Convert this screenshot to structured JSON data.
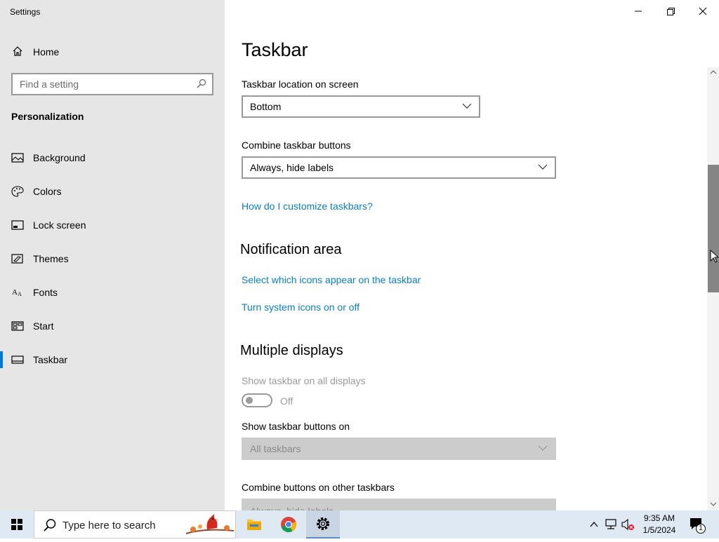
{
  "window": {
    "title": "Settings"
  },
  "sidebar": {
    "home_label": "Home",
    "search_placeholder": "Find a setting",
    "section": "Personalization",
    "items": [
      {
        "label": "Background",
        "icon": "picture-icon"
      },
      {
        "label": "Colors",
        "icon": "palette-icon"
      },
      {
        "label": "Lock screen",
        "icon": "lock-screen-icon"
      },
      {
        "label": "Themes",
        "icon": "themes-icon"
      },
      {
        "label": "Fonts",
        "icon": "fonts-icon"
      },
      {
        "label": "Start",
        "icon": "start-icon"
      },
      {
        "label": "Taskbar",
        "icon": "taskbar-icon",
        "active": true
      }
    ]
  },
  "main": {
    "title": "Taskbar",
    "location_label": "Taskbar location on screen",
    "location_value": "Bottom",
    "combine_label": "Combine taskbar buttons",
    "combine_value": "Always, hide labels",
    "customize_link": "How do I customize taskbars?",
    "notification_heading": "Notification area",
    "select_icons_link": "Select which icons appear on the taskbar",
    "system_icons_link": "Turn system icons on or off",
    "multiple_heading": "Multiple displays",
    "show_all_label": "Show taskbar on all displays",
    "show_all_state": "Off",
    "show_buttons_label": "Show taskbar buttons on",
    "show_buttons_value": "All taskbars",
    "combine_other_label": "Combine buttons on other taskbars",
    "combine_other_value": "Always, hide labels"
  },
  "taskbar": {
    "search_placeholder": "Type here to search",
    "time": "9:35 AM",
    "date": "1/5/2024",
    "notification_count": "1"
  },
  "colors": {
    "accent": "#0078d7",
    "link": "#0a7fc9",
    "sidebar_bg": "#e6e6e6"
  }
}
